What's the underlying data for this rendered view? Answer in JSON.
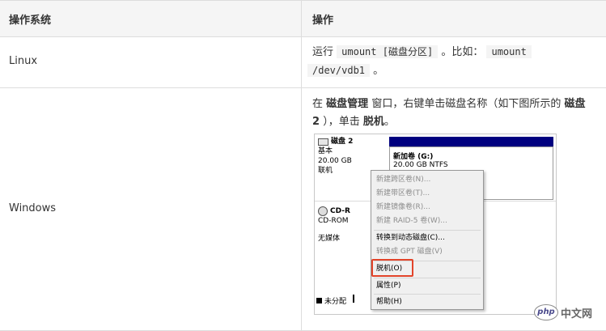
{
  "table": {
    "header": {
      "os": "操作系统",
      "action": "操作"
    },
    "linux": {
      "os": "Linux",
      "pre": "运行",
      "code1": "umount [磁盘分区]",
      "mid": "。比如：",
      "code2a": "umount",
      "code2b": "/dev/vdb1",
      "end": "。"
    },
    "windows": {
      "os": "Windows",
      "p1": "在",
      "b1": "磁盘管理",
      "p2": "窗口，右键单击磁盘名称（如下图所示的",
      "b2": "磁盘2",
      "p3": "），单击",
      "b3": "脱机",
      "p4": "。"
    }
  },
  "screenshot": {
    "disk2": {
      "name": "磁盘 2",
      "type": "基本",
      "size": "20.00 GB",
      "status": "联机"
    },
    "volume": {
      "name": "新加卷 (G:)",
      "size": "20.00 GB NTFS"
    },
    "cdrom": {
      "name": "CD-R",
      "type": "CD-ROM",
      "media": "无媒体"
    },
    "legend": "未分配",
    "menu": [
      {
        "label": "新建跨区卷(N)...",
        "disabled": true
      },
      {
        "label": "新建带区卷(T)...",
        "disabled": true
      },
      {
        "label": "新建镜像卷(R)...",
        "disabled": true
      },
      {
        "label": "新建 RAID-5 卷(W)...",
        "disabled": true
      },
      {
        "label": "转换到动态磁盘(C)...",
        "disabled": false
      },
      {
        "label": "转换成 GPT 磁盘(V)",
        "disabled": true
      },
      {
        "label": "脱机(O)",
        "disabled": false
      },
      {
        "label": "属性(P)",
        "disabled": false
      },
      {
        "label": "帮助(H)",
        "disabled": false
      }
    ]
  },
  "watermark": {
    "logo": "php",
    "text": "中文网"
  },
  "colors": {
    "highlight": "#e2442a",
    "volume_bar": "#00007f",
    "header_bg": "#f5f5f5"
  }
}
